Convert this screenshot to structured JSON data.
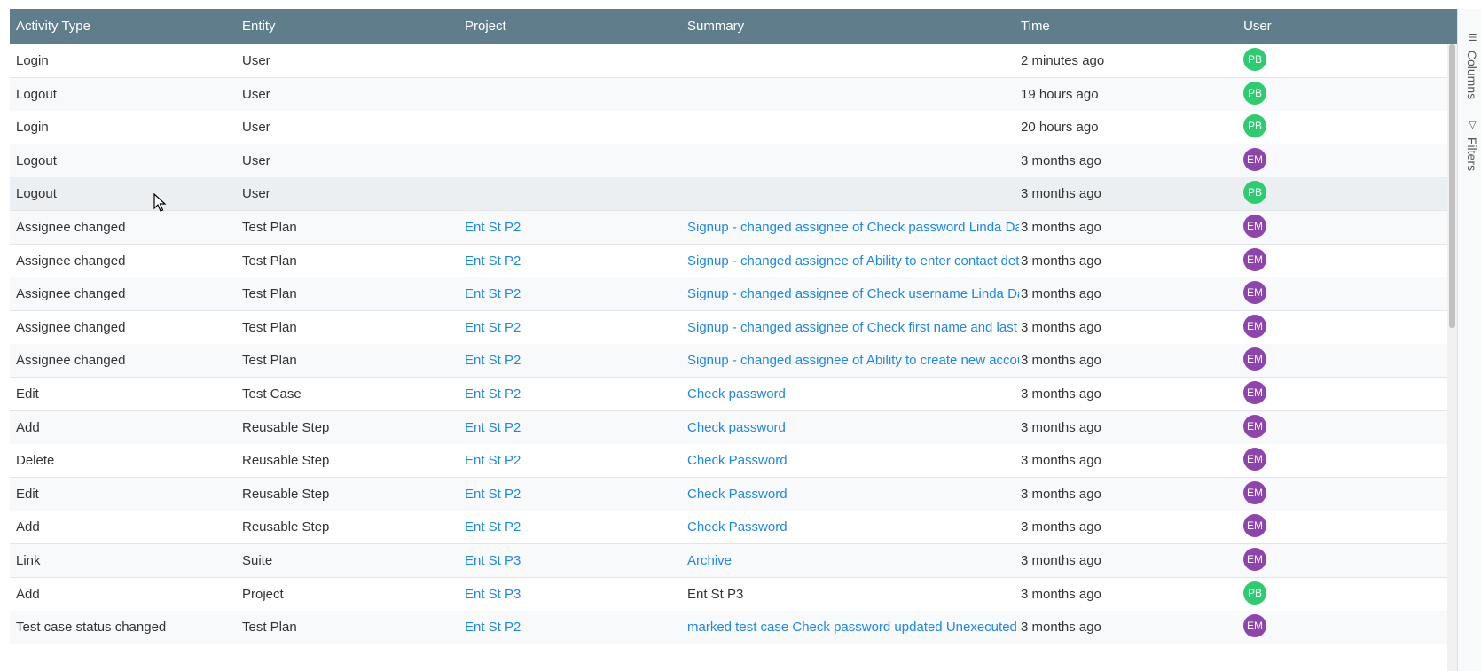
{
  "columns": {
    "activity_type": "Activity Type",
    "entity": "Entity",
    "project": "Project",
    "summary": "Summary",
    "time": "Time",
    "user": "User"
  },
  "side_panel": {
    "columns_label": "Columns",
    "filters_label": "Filters"
  },
  "colors": {
    "header_bg": "#607d8b",
    "link": "#1e88e5",
    "avatar_pb": "#2ecc71",
    "avatar_em": "#8e44ad"
  },
  "rows": [
    {
      "activity": "Login",
      "entity": "User",
      "project": "",
      "summary": "",
      "time": "2 minutes ago",
      "user": "PB"
    },
    {
      "activity": "Logout",
      "entity": "User",
      "project": "",
      "summary": "",
      "time": "19 hours ago",
      "user": "PB"
    },
    {
      "activity": "Login",
      "entity": "User",
      "project": "",
      "summary": "",
      "time": "20 hours ago",
      "user": "PB"
    },
    {
      "activity": "Logout",
      "entity": "User",
      "project": "",
      "summary": "",
      "time": "3 months ago",
      "user": "EM"
    },
    {
      "activity": "Logout",
      "entity": "User",
      "project": "",
      "summary": "",
      "time": "3 months ago",
      "user": "PB"
    },
    {
      "activity": "Assignee changed",
      "entity": "Test Plan",
      "project": "Ent St P2",
      "summary": "Signup - changed assignee of Check password Linda Dav",
      "time": "3 months ago",
      "user": "EM"
    },
    {
      "activity": "Assignee changed",
      "entity": "Test Plan",
      "project": "Ent St P2",
      "summary": "Signup - changed assignee of Ability to enter contact det",
      "time": "3 months ago",
      "user": "EM"
    },
    {
      "activity": "Assignee changed",
      "entity": "Test Plan",
      "project": "Ent St P2",
      "summary": "Signup - changed assignee of Check username Linda Da",
      "time": "3 months ago",
      "user": "EM"
    },
    {
      "activity": "Assignee changed",
      "entity": "Test Plan",
      "project": "Ent St P2",
      "summary": "Signup - changed assignee of Check first name and last n",
      "time": "3 months ago",
      "user": "EM"
    },
    {
      "activity": "Assignee changed",
      "entity": "Test Plan",
      "project": "Ent St P2",
      "summary": "Signup - changed assignee of Ability to create new accou",
      "time": "3 months ago",
      "user": "EM"
    },
    {
      "activity": "Edit",
      "entity": "Test Case",
      "project": "Ent St P2",
      "summary": "Check password",
      "time": "3 months ago",
      "user": "EM"
    },
    {
      "activity": "Add",
      "entity": "Reusable Step",
      "project": "Ent St P2",
      "summary": "Check password",
      "time": "3 months ago",
      "user": "EM"
    },
    {
      "activity": "Delete",
      "entity": "Reusable Step",
      "project": "Ent St P2",
      "summary": "Check Password",
      "time": "3 months ago",
      "user": "EM"
    },
    {
      "activity": "Edit",
      "entity": "Reusable Step",
      "project": "Ent St P2",
      "summary": "Check Password",
      "time": "3 months ago",
      "user": "EM"
    },
    {
      "activity": "Add",
      "entity": "Reusable Step",
      "project": "Ent St P2",
      "summary": "Check Password",
      "time": "3 months ago",
      "user": "EM"
    },
    {
      "activity": "Link",
      "entity": "Suite",
      "project": "Ent St P3",
      "summary": "Archive",
      "time": "3 months ago",
      "user": "EM"
    },
    {
      "activity": "Add",
      "entity": "Project",
      "project": "Ent St P3",
      "summary": "Ent St P3",
      "summary_plain": true,
      "time": "3 months ago",
      "user": "PB"
    },
    {
      "activity": "Test case status changed",
      "entity": "Test Plan",
      "project": "Ent St P2",
      "summary": "marked test case Check password updated Unexecuted",
      "time": "3 months ago",
      "user": "EM"
    }
  ]
}
